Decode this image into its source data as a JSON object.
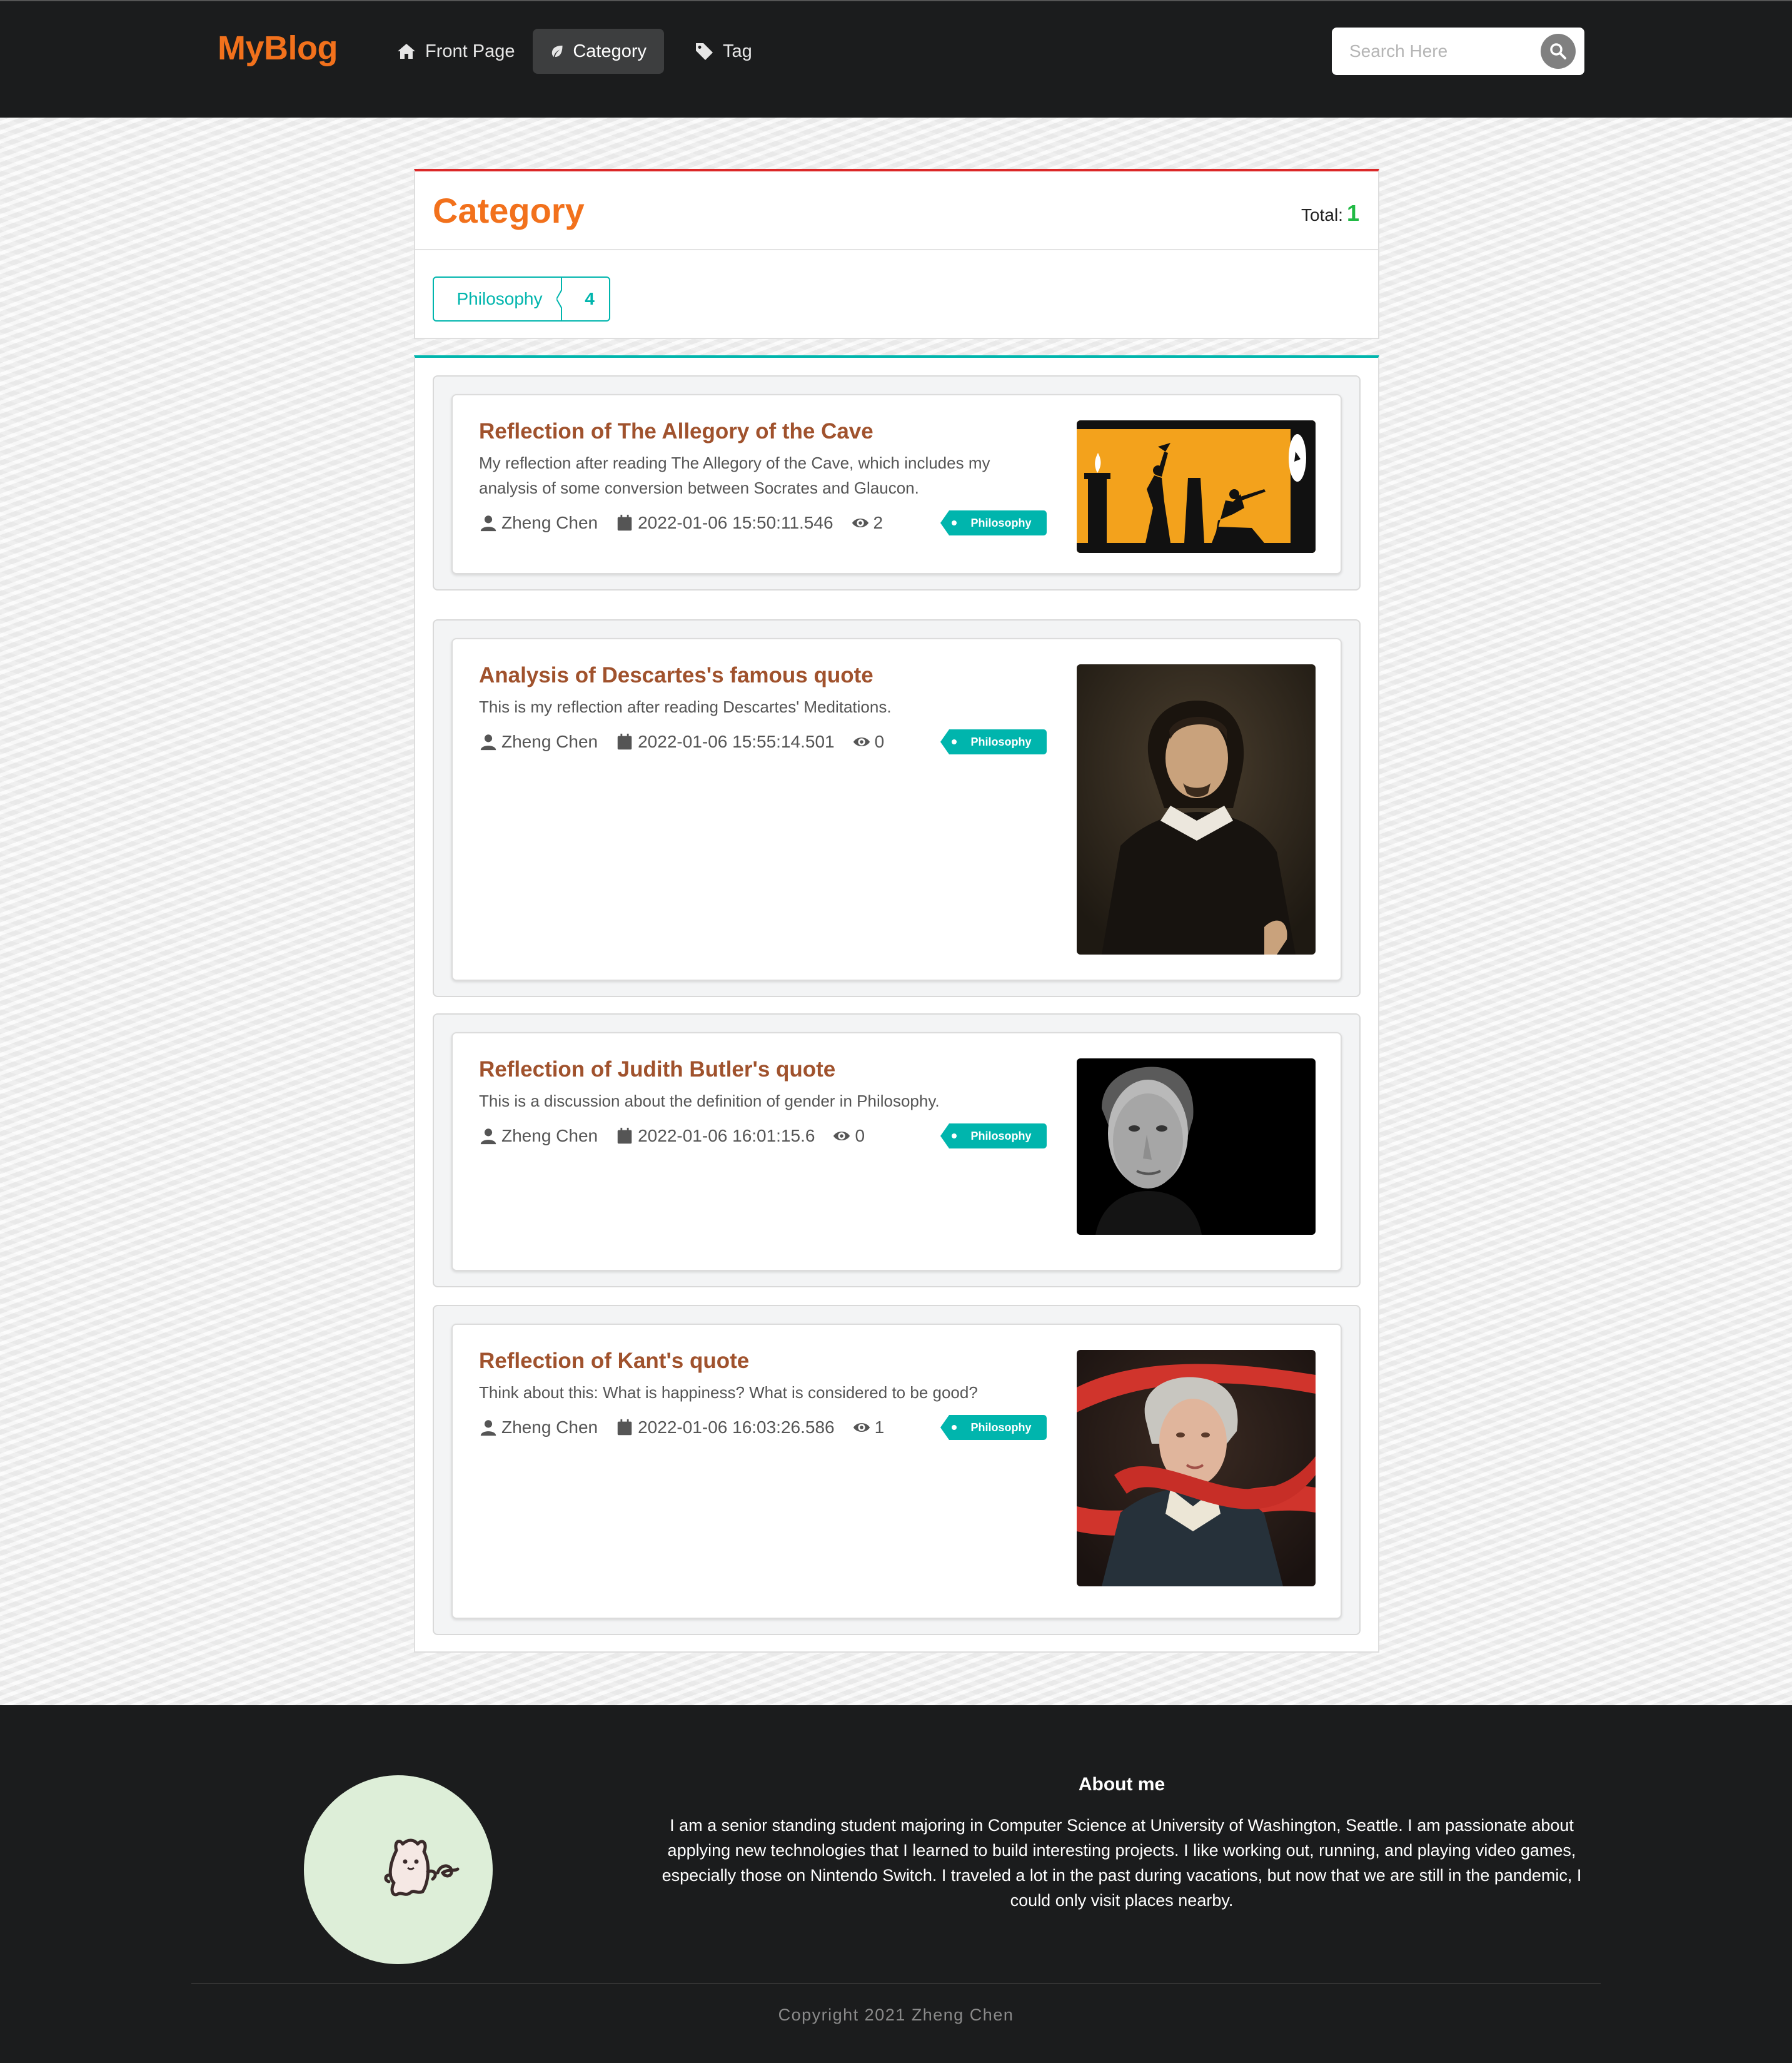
{
  "navbar": {
    "brand": "MyBlog",
    "items": [
      {
        "label": "Front Page",
        "icon": "home-icon"
      },
      {
        "label": "Category",
        "icon": "leaf-icon",
        "active": true
      },
      {
        "label": "Tag",
        "icon": "tag-icon"
      }
    ],
    "search": {
      "placeholder": "Search Here",
      "icon": "search-icon"
    }
  },
  "category_card": {
    "title": "Category",
    "total_label": "Total:",
    "total": "1",
    "categories": [
      {
        "name": "Philosophy",
        "count": "4"
      }
    ]
  },
  "posts": [
    {
      "title": "Reflection of The Allegory of the Cave",
      "description": "My reflection after reading The Allegory of the Cave, which includes my analysis of some conversion between Socrates and Glaucon.",
      "author": "Zheng Chen",
      "date": "2022-01-06 15:50:11.546",
      "views": "2",
      "tag": "Philosophy",
      "image": "allegory-of-cave-illustration"
    },
    {
      "title": "Analysis of Descartes's famous quote",
      "description": "This is my reflection after reading Descartes' Meditations.",
      "author": "Zheng Chen",
      "date": "2022-01-06 15:55:14.501",
      "views": "0",
      "tag": "Philosophy",
      "image": "descartes-portrait"
    },
    {
      "title": "Reflection of Judith Butler's quote",
      "description": "This is a discussion about the definition of gender in Philosophy.",
      "author": "Zheng Chen",
      "date": "2022-01-06 16:01:15.6",
      "views": "0",
      "tag": "Philosophy",
      "image": "judith-butler-portrait"
    },
    {
      "title": "Reflection of Kant's quote",
      "description": "Think about this: What is happiness? What is considered to be good?",
      "author": "Zheng Chen",
      "date": "2022-01-06 16:03:26.586",
      "views": "1",
      "tag": "Philosophy",
      "image": "kant-portrait"
    }
  ],
  "footer": {
    "about_title": "About me",
    "about_text": "I am a senior standing student majoring in Computer Science at University of Washington, Seattle. I am passionate about applying new technologies that I learned to build interesting projects. I like working out, running, and playing video games, especially those on Nintendo Switch. I traveled a lot in the past during vacations, but now that we are still in the pandemic, I could only visit places nearby.",
    "copyright": "Copyright 2021 Zheng Chen"
  },
  "colors": {
    "brand": "#f2711c",
    "nav_bg": "#1b1c1d",
    "teal": "#00b5ad",
    "red_accent": "#db2828",
    "green_total": "#21ba45",
    "post_title": "#a0522d"
  }
}
